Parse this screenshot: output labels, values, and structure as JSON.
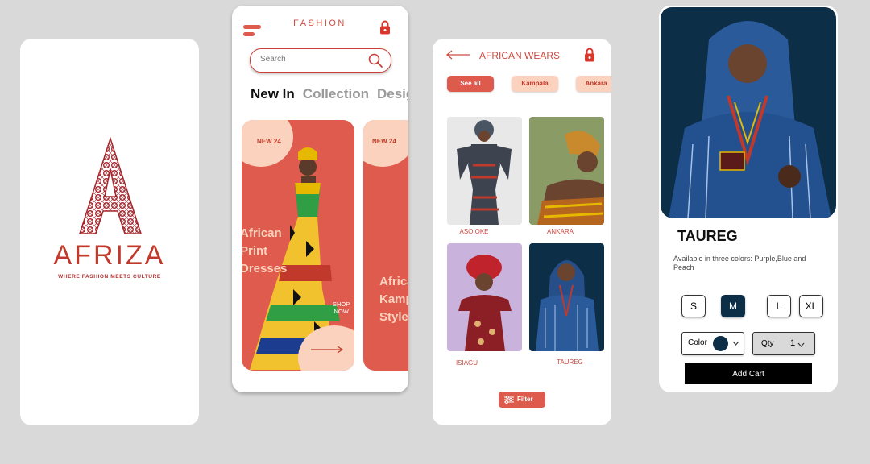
{
  "splash": {
    "brand": "AFRIZA",
    "tagline": "WHERE FASHION MEETS CULTURE",
    "colors": {
      "brand": "#c0392b"
    }
  },
  "home": {
    "title": "FASHION",
    "search_placeholder": "Search",
    "tabs": [
      {
        "label": "New In",
        "active": true
      },
      {
        "label": "Collection",
        "active": false
      },
      {
        "label": "Design",
        "active": false
      }
    ],
    "cards": [
      {
        "badge": "NEW 24",
        "line1": "African",
        "line2": "Print",
        "line3": "Dresses",
        "cta": "SHOP",
        "cta2": "NOW"
      },
      {
        "badge": "NEW 24",
        "line1": "African",
        "line2": "Kampala",
        "line3": "Styles"
      }
    ],
    "colors": {
      "accent": "#df5b4e",
      "soft": "#fbd2bd"
    }
  },
  "category": {
    "title": "AFRICAN WEARS",
    "chips": [
      {
        "label": "See all",
        "active": true
      },
      {
        "label": "Kampala",
        "active": false
      },
      {
        "label": "Ankara",
        "active": false
      }
    ],
    "items": [
      {
        "label": "ASO OKE"
      },
      {
        "label": "ANKARA"
      },
      {
        "label": "ISIAGU"
      },
      {
        "label": "TAUREG"
      }
    ],
    "filter_label": "Filter"
  },
  "product": {
    "name": "TAUREG",
    "description": "Available in three colors: Purple,Blue and Peach",
    "sizes": [
      {
        "label": "S",
        "selected": false
      },
      {
        "label": "M",
        "selected": true
      },
      {
        "label": "L",
        "selected": false
      },
      {
        "label": "XL",
        "selected": false
      }
    ],
    "color_label": "Color",
    "selected_color": "#0d2e47",
    "qty_label": "Qty",
    "qty_value": "1",
    "add_cart_label": "Add Cart"
  }
}
